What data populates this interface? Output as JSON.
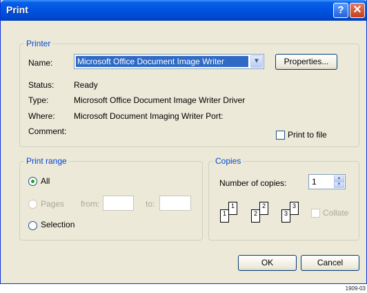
{
  "window": {
    "title": "Print",
    "help_label": "?",
    "close_label": "✕"
  },
  "printer": {
    "group_label": "Printer",
    "name_label": "Name:",
    "name_value": "Microsoft Office Document Image Writer",
    "properties_label": "Properties...",
    "status_label": "Status:",
    "status_value": "Ready",
    "type_label": "Type:",
    "type_value": "Microsoft Office Document Image Writer Driver",
    "where_label": "Where:",
    "where_value": "Microsoft Document Imaging Writer Port:",
    "comment_label": "Comment:",
    "comment_value": "",
    "print_to_file_label": "Print to file",
    "print_to_file_checked": false
  },
  "print_range": {
    "group_label": "Print range",
    "all_label": "All",
    "all_selected": true,
    "pages_label": "Pages",
    "from_label": "from:",
    "from_value": "",
    "to_label": "to:",
    "to_value": "",
    "selection_label": "Selection"
  },
  "copies": {
    "group_label": "Copies",
    "number_label": "Number of copies:",
    "number_value": "1",
    "collate_label": "Collate",
    "collate_checked": false,
    "page_icon_labels": [
      "1",
      "1",
      "2",
      "2",
      "3",
      "3"
    ]
  },
  "buttons": {
    "ok_label": "OK",
    "cancel_label": "Cancel"
  },
  "figure_code": "1909-03"
}
